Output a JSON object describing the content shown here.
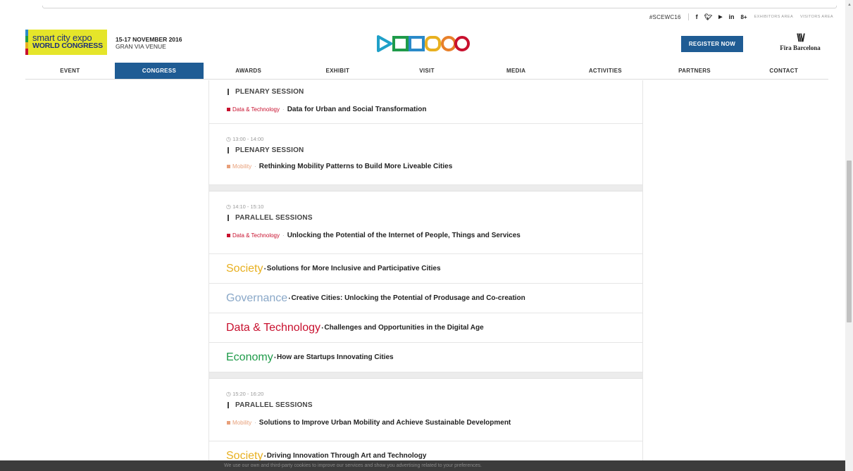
{
  "utility": {
    "hashtag": "#SCEWC16",
    "social": [
      "f",
      "…",
      "You",
      "in",
      "8+"
    ],
    "exhibitors_area": "EXHIBITORS AREA",
    "visitors_area": "VISITORS AREA"
  },
  "logo": {
    "line1": "smart city expo",
    "line2": "WORLD CONGRESS"
  },
  "event": {
    "date": "15-17 NOVEMBER 2016",
    "venue": "GRAN VIA VENUE"
  },
  "header": {
    "register_label": "REGISTER NOW",
    "partner_name": "Fira Barcelona"
  },
  "nav": [
    {
      "label": "EVENT",
      "active": false
    },
    {
      "label": "CONGRESS",
      "active": true
    },
    {
      "label": "AWARDS",
      "active": false
    },
    {
      "label": "EXHIBIT",
      "active": false
    },
    {
      "label": "VISIT",
      "active": false
    },
    {
      "label": "MEDIA",
      "active": false
    },
    {
      "label": "ACTIVITIES",
      "active": false
    },
    {
      "label": "PARTNERS",
      "active": false
    },
    {
      "label": "CONTACT",
      "active": false
    }
  ],
  "colors": {
    "data_technology": "#c8102e",
    "mobility": "#e8a07a",
    "society": "#e8b020",
    "governance": "#8aa8c8",
    "economy": "#1f9b4a",
    "accent": "#1f5c94"
  },
  "schedule": {
    "block0": {
      "session": "PLENARY SESSION",
      "talk": {
        "category": "Data & Technology",
        "title": "Data for Urban and Social Transformation"
      }
    },
    "block1": {
      "time": "13:00 - 14:00",
      "session": "PLENARY SESSION",
      "talk": {
        "category": "Mobility",
        "title": "Rethinking Mobility Patterns to Build More Liveable Cities"
      }
    },
    "block2": {
      "time": "14:10 - 15:10",
      "session": "PARALLEL SESSIONS",
      "talks": [
        {
          "category": "Data & Technology",
          "title": "Unlocking the Potential of the Internet of People, Things and Services"
        },
        {
          "category": "Society",
          "title": "Solutions for More Inclusive and Participative Cities"
        },
        {
          "category": "Governance",
          "title": "Creative Cities: Unlocking the Potential of Produsage and Co-creation"
        },
        {
          "category": "Data & Technology",
          "title": "Challenges and Opportunities in the Digital Age"
        },
        {
          "category": "Economy",
          "title": "How are Startups Innovating Cities"
        }
      ]
    },
    "block3": {
      "time": "15:20 - 16:20",
      "session": "PARALLEL SESSIONS",
      "talks": [
        {
          "category": "Mobility",
          "title": "Solutions to Improve Urban Mobility and Achieve Sustainable Development"
        },
        {
          "category": "Society",
          "title": "Driving Innovation Through Art and Technology"
        }
      ]
    }
  },
  "cookie": {
    "text": "We use our own and third-party cookies to improve our services and show you advertising related to your preferences."
  }
}
